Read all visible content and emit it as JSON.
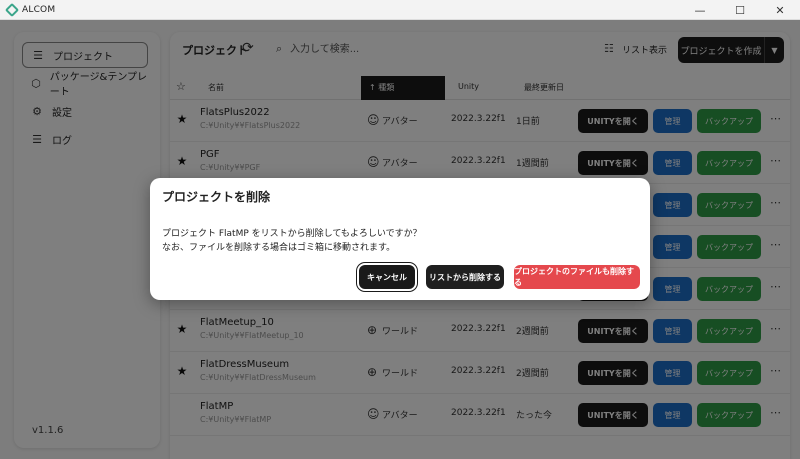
{
  "window": {
    "title": "ALCOM",
    "controls": [
      "—",
      "☐",
      "✕"
    ]
  },
  "sidebar": {
    "items": [
      {
        "label": "プロジェクト",
        "icon": "list-icon",
        "glyph": "☰",
        "active": true
      },
      {
        "label": "パッケージ&テンプレート",
        "icon": "package-icon",
        "glyph": "⬡",
        "active": false
      },
      {
        "label": "設定",
        "icon": "gear-icon",
        "glyph": "⚙",
        "active": false
      },
      {
        "label": "ログ",
        "icon": "log-icon",
        "glyph": "☰",
        "active": false
      }
    ],
    "version": "v1.1.6"
  },
  "toolbar": {
    "title": "プロジェクト",
    "search_placeholder": "入力して検索...",
    "list_view_label": "リスト表示",
    "create_label": "プロジェクトを作成"
  },
  "table": {
    "headers": {
      "name": "名前",
      "type": "種類",
      "unity": "Unity",
      "updated": "最終更新日"
    },
    "sorted_indicator": "↑",
    "rows": [
      {
        "starred": true,
        "name": "FlatsPlus2022",
        "path": "C:¥Unity¥¥FlatsPlus2022",
        "type": "アバター",
        "type_icon": "avatar-icon",
        "unity": "2022.3.22f1",
        "updated": "1日前"
      },
      {
        "starred": true,
        "name": "PGF",
        "path": "C:¥Unity¥¥PGF",
        "type": "アバター",
        "type_icon": "avatar-icon",
        "unity": "2022.3.22f1",
        "updated": "1週間前"
      },
      {
        "starred": false,
        "name": "",
        "path": "",
        "type": "",
        "type_icon": "avatar-icon",
        "unity": "",
        "updated": ""
      },
      {
        "starred": false,
        "name": "",
        "path": "",
        "type": "",
        "type_icon": "avatar-icon",
        "unity": "",
        "updated": ""
      },
      {
        "starred": false,
        "name": "",
        "path": "",
        "type": "",
        "type_icon": "avatar-icon",
        "unity": "",
        "updated": ""
      },
      {
        "starred": true,
        "name": "FlatMeetup_10",
        "path": "C:¥Unity¥¥FlatMeetup_10",
        "type": "ワールド",
        "type_icon": "world-icon",
        "unity": "2022.3.22f1",
        "updated": "2週間前"
      },
      {
        "starred": true,
        "name": "FlatDressMuseum",
        "path": "C:¥Unity¥¥FlatDressMuseum",
        "type": "ワールド",
        "type_icon": "world-icon",
        "unity": "2022.3.22f1",
        "updated": "2週間前"
      },
      {
        "starred": false,
        "name": "FlatMP",
        "path": "C:¥Unity¥¥FlatMP",
        "type": "アバター",
        "type_icon": "avatar-icon",
        "unity": "2022.3.22f1",
        "updated": "たった今"
      }
    ],
    "row_buttons": {
      "open": "UNITYを開く",
      "manage": "管理",
      "backup": "バックアップ"
    }
  },
  "dialog": {
    "title": "プロジェクトを削除",
    "message_line1": "プロジェクト FlatMP をリストから削除してもよろしいですか？",
    "message_line2": "なお、ファイルを削除する場合はゴミ箱に移動されます。",
    "cancel_label": "キャンセル",
    "remove_label": "リストから削除する",
    "delete_label": "プロジェクトのファイルも削除する"
  },
  "colors": {
    "accent_dark": "#1a1a1a",
    "manage_blue": "#1d6ec9",
    "backup_green": "#2e9c46",
    "danger_red": "#e5484d"
  }
}
